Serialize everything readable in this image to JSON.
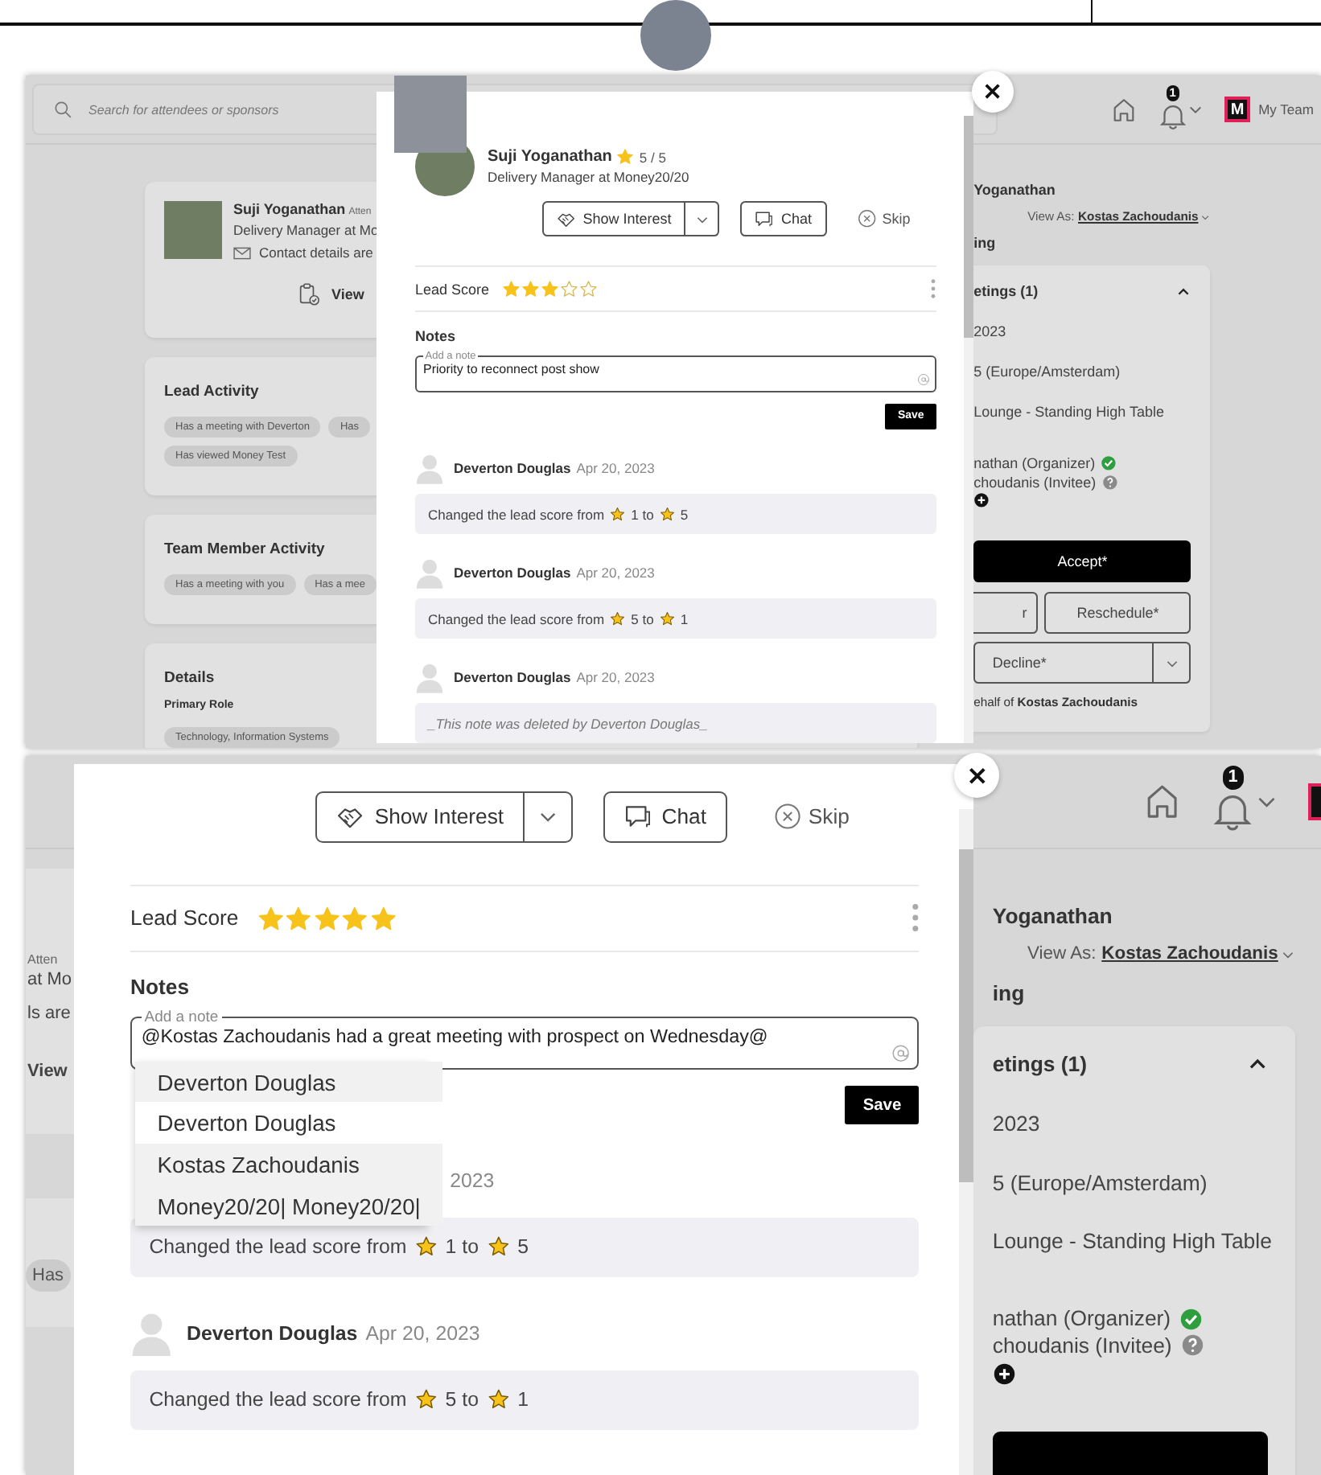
{
  "screenshots": [
    {
      "header": {
        "search": {
          "placeholder": "Search for attendees or sponsors"
        },
        "notification_count": "1",
        "logo_text": "M",
        "team_label": "My Team"
      },
      "left_column": {
        "kind": "full",
        "profile": {
          "name": "Suji Yoganathan",
          "role_badge": "Atten",
          "title": "Delivery Manager at Mo",
          "contact": "Contact details are",
          "view": "View"
        },
        "sections": [
          {
            "kind": "tags",
            "title": "Lead Activity",
            "tags": [
              "Has a meeting with Deverton",
              "Has",
              "Has viewed Money Test"
            ]
          },
          {
            "kind": "tags",
            "title": "Team Member Activity",
            "tags": [
              "Has a meeting with you",
              "Has a mee"
            ]
          },
          {
            "kind": "details",
            "title": "Details",
            "label": "Primary Role",
            "tags": [
              "Technology, Information Systems"
            ]
          }
        ]
      },
      "right_column": {
        "name": "Yoganathan",
        "view_as_label": "View As:",
        "view_as_value": "Kostas Zachoudanis",
        "section": "ing",
        "meetings": {
          "title": "etings (1)",
          "expanded": true,
          "lines": [
            "2023",
            "5 (Europe/Amsterdam)",
            "Lounge - Standing High Table"
          ],
          "attendees": [
            {
              "name": "nathan (Organizer)",
              "kind": "accepted"
            },
            {
              "name": "choudanis (Invitee)",
              "kind": "pending"
            }
          ],
          "buttons": [
            {
              "kind": "primary",
              "label": "Accept*"
            },
            {
              "kind": "pair",
              "labels": [
                "r",
                "Reschedule*"
              ]
            },
            {
              "kind": "split",
              "label": "Decline*"
            }
          ],
          "footer": "ehalf of **Kostas Zachoudanis**"
        }
      },
      "modal": {
        "profile": {
          "name": "Suji Yoganathan",
          "rating": "5 / 5",
          "title": "Delivery Manager at Money20/20"
        },
        "actions": {
          "show_interest": "Show Interest",
          "chat": "Chat",
          "skip": "Skip"
        },
        "lead_score": {
          "label": "Lead Score",
          "stars": 3
        },
        "notes": {
          "title": "Notes",
          "field": {
            "label": "Add a note",
            "value": "Priority to reconnect post show"
          },
          "save": "Save"
        },
        "activity": [
          {
            "kind": "score_change",
            "author": "Deverton Douglas",
            "date": "Apr 20, 2023",
            "segments": [
              "Changed the lead score from",
              "1 to",
              "5"
            ]
          },
          {
            "kind": "score_change",
            "author": "Deverton Douglas",
            "date": "Apr 20, 2023",
            "segments": [
              "Changed the lead score from",
              "5 to",
              "1"
            ]
          },
          {
            "kind": "deleted",
            "author": "Deverton Douglas",
            "date": "Apr 20, 2023",
            "text": "_This note was deleted by Deverton Douglas_"
          }
        ]
      }
    },
    {
      "header": {
        "notification_count": "1"
      },
      "left_column": {
        "kind": "edge",
        "profile": {
          "role_badge": "Atten",
          "title": "at Mo",
          "contact": "ls are",
          "view": "View"
        },
        "sections": [
          {
            "kind": "tags",
            "tags": [
              "Has"
            ]
          }
        ]
      },
      "right_column": {
        "name": "Yoganathan",
        "view_as_label": "View As:",
        "view_as_value": "Kostas Zachoudanis",
        "section": "ing",
        "meetings": {
          "title": "etings (1)",
          "expanded": true,
          "lines": [
            "2023",
            "5 (Europe/Amsterdam)",
            "Lounge - Standing High Table"
          ],
          "attendees": [
            {
              "name": "nathan (Organizer)",
              "kind": "accepted"
            },
            {
              "name": "choudanis (Invitee)",
              "kind": "pending"
            }
          ],
          "buttons": [
            {
              "kind": "primary"
            }
          ]
        }
      },
      "modal": {
        "actions": {
          "show_interest": "Show Interest",
          "chat": "Chat",
          "skip": "Skip"
        },
        "lead_score": {
          "label": "Lead Score",
          "stars": 5
        },
        "notes": {
          "title": "Notes",
          "field": {
            "label": "Add a note",
            "value": "@Kostas Zachoudanis had a great meeting with prospect on Wednesday@"
          },
          "save": "Save",
          "mention_suggestions": [
            {
              "name": "Deverton Douglas",
              "selected": false
            },
            {
              "name": "Deverton Douglas",
              "selected": true
            },
            {
              "name": "Kostas Zachoudanis",
              "selected": false
            },
            {
              "name": "Money20/20| Money20/20|",
              "selected": false
            }
          ]
        },
        "activity": [
          {
            "kind": "score_change",
            "date": "2023",
            "segments": [
              "Changed the lead score from",
              "1 to",
              "5"
            ]
          },
          {
            "kind": "score_change",
            "author": "Deverton Douglas",
            "date": "Apr 20, 2023",
            "segments": [
              "Changed the lead score from",
              "5 to",
              "1"
            ]
          }
        ]
      }
    }
  ]
}
